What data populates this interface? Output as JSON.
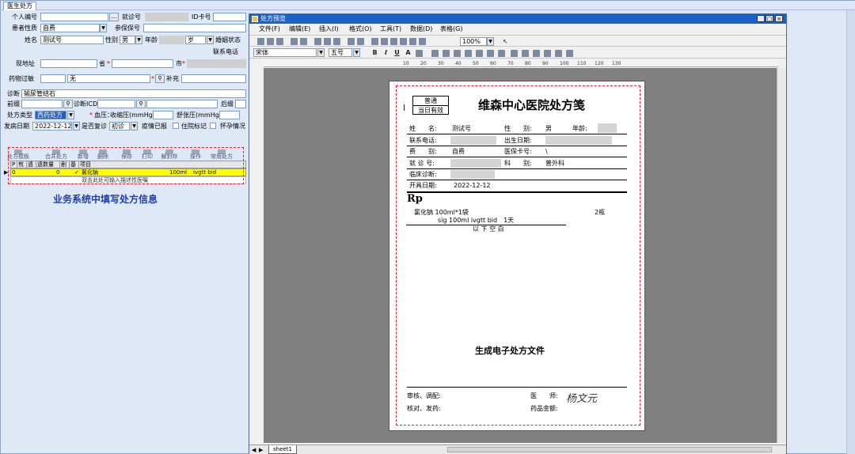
{
  "app": {
    "tab": "医生处方"
  },
  "form": {
    "personal_id_label": "个人编号",
    "visit_no_label": "就诊号",
    "id_card_label": "ID卡号",
    "patient_type_label": "患者性质",
    "patient_type_value": "自费",
    "insurance_no_label": "参保保号",
    "name_label": "姓名",
    "name_value": "测试号",
    "gender_label": "性别",
    "gender_value": "男",
    "age_label": "年龄",
    "age_unit": "岁",
    "marital_label": "婚姻状态",
    "contact_label": "联系电话",
    "address_label": "现地址",
    "province_label": "省",
    "city_label": "市",
    "allergy_label": "药物过敏",
    "allergy_value": "无",
    "supplement_label": "补充",
    "diagnosis_label": "诊断",
    "diagnosis_value": "输尿管结石",
    "pre_label": "前缀",
    "diag_icd_label": "诊断ICD",
    "post_label": "后缀",
    "rx_type_label": "处方类型",
    "rx_type_value": "西药处方",
    "bp_label": "血压：",
    "systolic_label": "收缩压(mmHg)",
    "diastolic_label": "舒张压(mmHg)",
    "onset_label": "发病日期",
    "onset_value": "2022-12-12",
    "revisit_label": "是否复诊",
    "revisit_value": "初诊",
    "reported_label": "疫情已报",
    "inpatient_label": "住院标记",
    "pregnant_label": "怀孕情况"
  },
  "toolbar": {
    "items": [
      "处方模板",
      "合并处方",
      "新增",
      "删除",
      "保存",
      "打印",
      "解封存",
      "操作",
      "常用处方"
    ]
  },
  "grid": {
    "headers": [
      "P",
      "煎",
      "遗",
      "遗数量",
      "剧",
      "基",
      "项目"
    ],
    "row1": {
      "count": "0",
      "check": "✓",
      "drug": "氯化钠",
      "spec": "100ml",
      "usage": "ivgtt bid"
    },
    "row2_hint": "双击此处可输入描述性医嘱"
  },
  "caption_left": "业务系统中填写处方信息",
  "preview": {
    "title": "处方预览",
    "window_buttons": [
      "_",
      "□",
      "×"
    ],
    "menu": [
      "文件(F)",
      "编辑(E)",
      "插入(I)",
      "格式(O)",
      "工具(T)",
      "数据(D)",
      "表格(G)"
    ],
    "zoom": "100%",
    "font": "宋体",
    "font_size": "五号",
    "ruler_ticks": [
      "10",
      "20",
      "30",
      "40",
      "50",
      "60",
      "70",
      "80",
      "90",
      "100",
      "110",
      "120",
      "130"
    ],
    "sheet_tab": "sheet1"
  },
  "rx": {
    "badge_top": "普通",
    "badge_bottom": "当日有效",
    "hospital": "维森中心医院处方笺",
    "name_label": "姓　　名:",
    "name_value": "测试号",
    "gender_label": "性　　别:",
    "gender_value": "男",
    "age_label": "年龄:",
    "phone_label": "联系电话:",
    "birth_label": "出生日期:",
    "fee_label": "费　　别:",
    "fee_value": "自费",
    "card_label": "医保卡号:",
    "card_value": "\\",
    "visit_label": "就 诊 号:",
    "dept_label": "科　　别:",
    "dept_value": "普外科",
    "clinical_label": "临床诊断:",
    "date_label": "开具日期:",
    "date_value": "2022-12-12",
    "rp": "Rp",
    "drug_line": "氯化钠 100ml*1袋",
    "qty": "2瓶",
    "sig_line": "sig 100ml ivgtt bid　1天",
    "blank_below": "以 下 空 白",
    "caption": "生成电子处方文件",
    "review_label": "审核、调配:",
    "doctor_label": "医　　师:",
    "doctor_signature": "杨文元",
    "check_label": "核对、发药:",
    "amount_label": "药品金额:"
  }
}
